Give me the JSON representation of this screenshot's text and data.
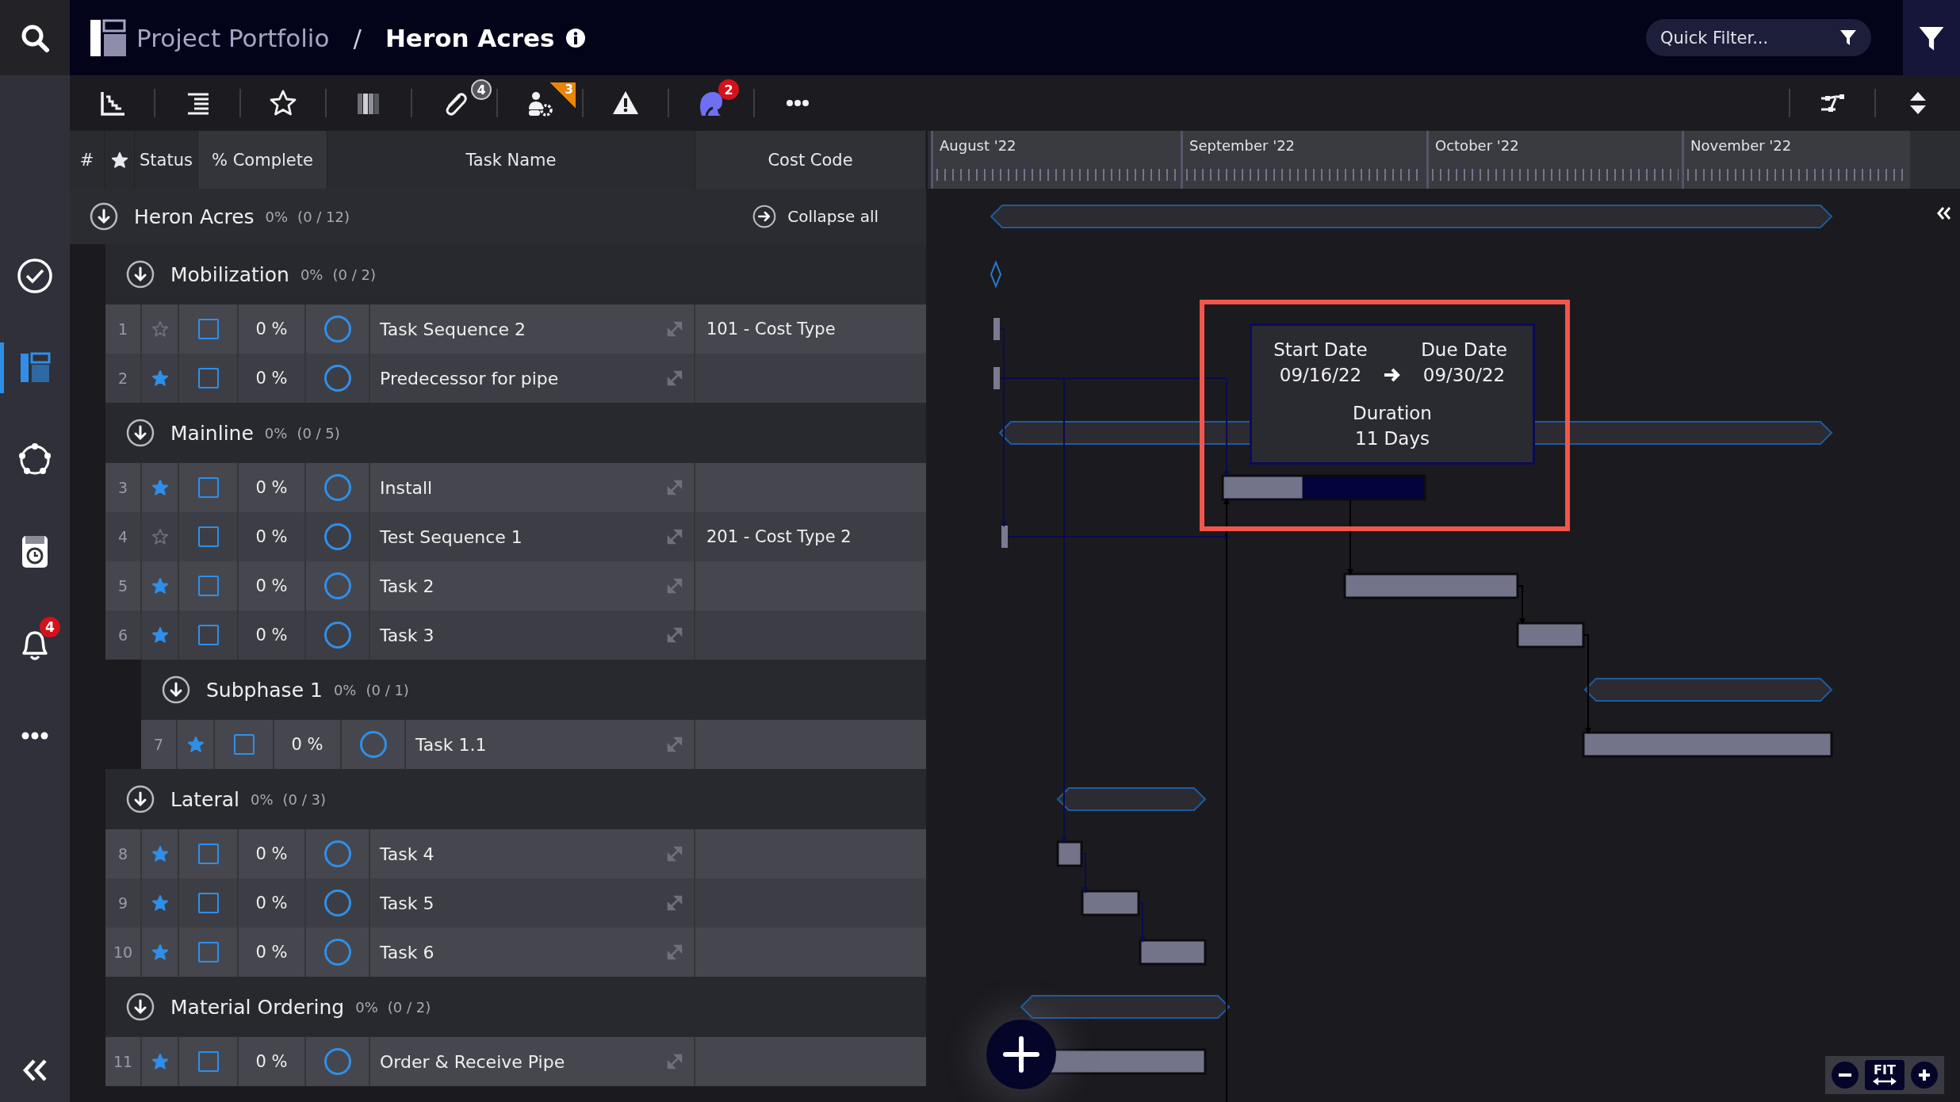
{
  "top_bar": {
    "breadcrumb": [
      {
        "label": "Project Portfolio",
        "current": false
      },
      {
        "label": "Heron Acres",
        "current": true
      }
    ],
    "separator": "/",
    "quick_filter": {
      "placeholder": "Quick Filter..."
    }
  },
  "sidebar": {
    "items": [
      {
        "kind": "tasks",
        "selected": false
      },
      {
        "kind": "portfolio",
        "selected": true
      },
      {
        "kind": "network",
        "selected": false
      },
      {
        "kind": "timesheet",
        "selected": false
      },
      {
        "kind": "notifications",
        "selected": false,
        "badge": "4"
      },
      {
        "kind": "more",
        "selected": false
      }
    ]
  },
  "toolbar": {
    "tools": [
      {
        "kind": "chart"
      },
      {
        "kind": "outline"
      },
      {
        "kind": "star"
      },
      {
        "kind": "columns"
      },
      {
        "kind": "attachments",
        "badge": "4"
      },
      {
        "kind": "resources",
        "badge": "3"
      },
      {
        "kind": "warnings"
      },
      {
        "kind": "assignee",
        "badge": "2"
      },
      {
        "kind": "more"
      }
    ],
    "right_tools": [
      {
        "kind": "network"
      },
      {
        "kind": "expand"
      }
    ]
  },
  "table": {
    "columns": [
      {
        "kind": "text",
        "label": "#"
      },
      {
        "kind": "star"
      },
      {
        "kind": "text",
        "label": "Status"
      },
      {
        "kind": "text",
        "label": "% Complete"
      },
      {
        "kind": "text",
        "label": "Task Name"
      },
      {
        "kind": "text",
        "label": "Cost Code"
      }
    ]
  },
  "project": {
    "name": "Heron Acres",
    "percent": "0%",
    "count": "(0 / 12)",
    "expanded": true,
    "collapse_all": "Collapse all",
    "children": [
      {
        "kind": "group",
        "name": "Mobilization",
        "percent": "0%",
        "count": "(0 / 2)",
        "expanded": true,
        "children": [
          {
            "kind": "task",
            "number": "1",
            "starred": false,
            "checked": false,
            "percent": "0 %",
            "name": "Task Sequence 2",
            "cost_code": "101 - Cost Type"
          },
          {
            "kind": "task",
            "number": "2",
            "starred": true,
            "checked": false,
            "percent": "0 %",
            "name": "Predecessor for pipe"
          }
        ]
      },
      {
        "kind": "group",
        "name": "Mainline",
        "percent": "0%",
        "count": "(0 / 5)",
        "expanded": true,
        "children": [
          {
            "kind": "task",
            "number": "3",
            "starred": true,
            "checked": false,
            "percent": "0 %",
            "name": "Install"
          },
          {
            "kind": "task",
            "number": "4",
            "starred": false,
            "checked": false,
            "percent": "0 %",
            "name": "Test Sequence 1",
            "cost_code": "201 - Cost Type 2"
          },
          {
            "kind": "task",
            "number": "5",
            "starred": true,
            "checked": false,
            "percent": "0 %",
            "name": "Task 2"
          },
          {
            "kind": "task",
            "number": "6",
            "starred": true,
            "checked": false,
            "percent": "0 %",
            "name": "Task 3"
          },
          {
            "kind": "group",
            "name": "Subphase 1",
            "percent": "0%",
            "count": "(0 / 1)",
            "expanded": true,
            "children": [
              {
                "kind": "task",
                "number": "7",
                "starred": true,
                "checked": false,
                "percent": "0 %",
                "name": "Task 1.1"
              }
            ]
          }
        ]
      },
      {
        "kind": "group",
        "name": "Lateral",
        "percent": "0%",
        "count": "(0 / 3)",
        "expanded": true,
        "children": [
          {
            "kind": "task",
            "number": "8",
            "starred": true,
            "checked": false,
            "percent": "0 %",
            "name": "Task 4"
          },
          {
            "kind": "task",
            "number": "9",
            "starred": true,
            "checked": false,
            "percent": "0 %",
            "name": "Task 5"
          },
          {
            "kind": "task",
            "number": "10",
            "starred": true,
            "checked": false,
            "percent": "0 %",
            "name": "Task 6"
          }
        ]
      },
      {
        "kind": "group",
        "name": "Material Ordering",
        "percent": "0%",
        "count": "(0 / 2)",
        "expanded": true,
        "children": [
          {
            "kind": "task",
            "number": "11",
            "starred": true,
            "checked": false,
            "percent": "0 %",
            "name": "Order & Receive Pipe"
          }
        ]
      }
    ]
  },
  "timeline": {
    "months": [
      "August '22",
      "September '22",
      "October '22",
      "November '22"
    ]
  },
  "tooltip": {
    "start_label": "Start Date",
    "start": "09/16/22",
    "due_label": "Due Date",
    "due": "09/30/22",
    "duration_label": "Duration",
    "duration": "11 Days"
  },
  "zoom_controls": {
    "fit": "FIT"
  }
}
